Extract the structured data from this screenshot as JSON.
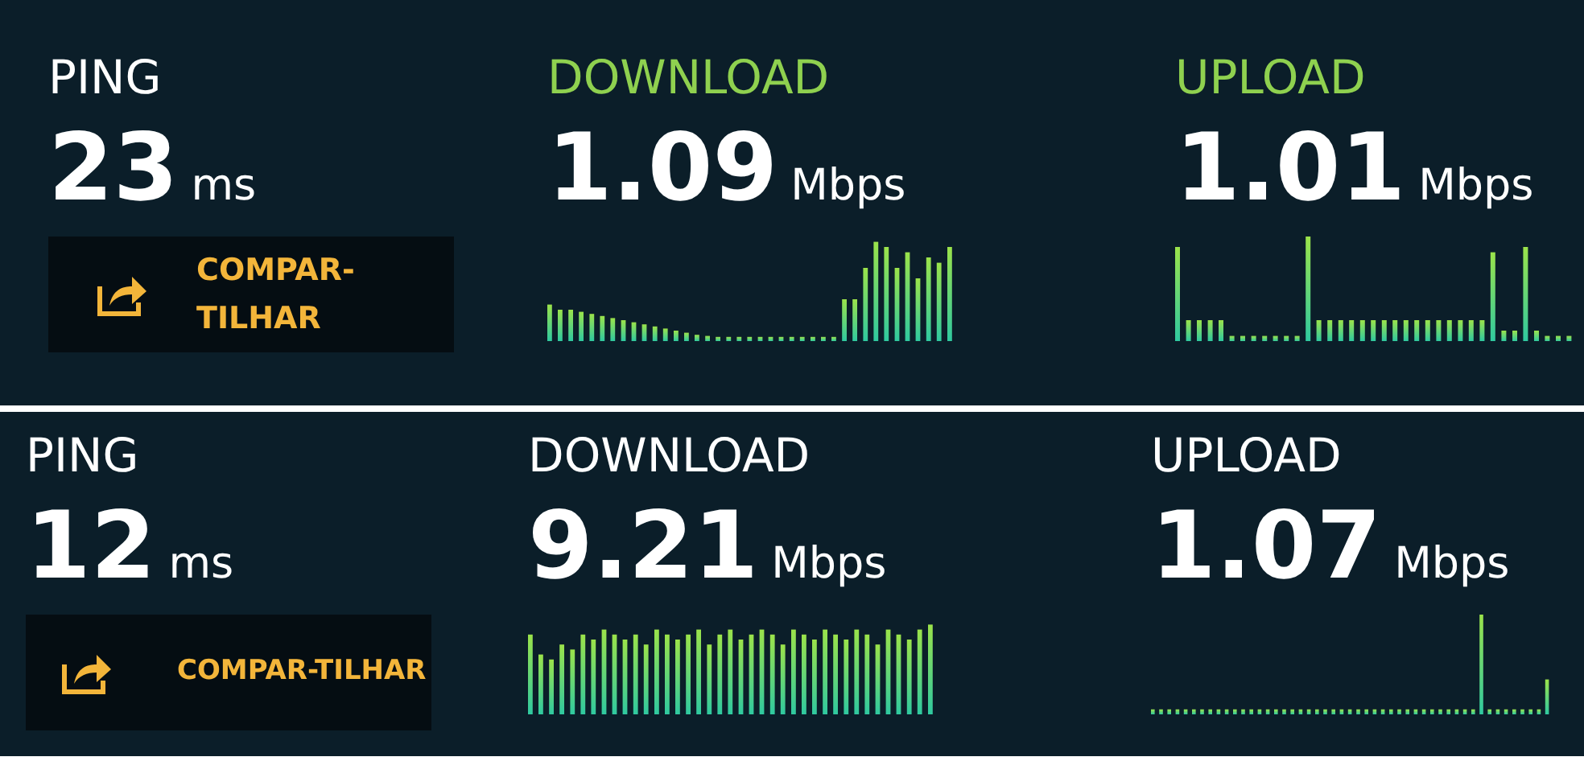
{
  "panels": [
    {
      "metrics": [
        {
          "label": "PING",
          "value": "23",
          "unit": "ms",
          "color": "#ffffff"
        },
        {
          "label": "DOWNLOAD",
          "value": "1.09",
          "unit": "Mbps",
          "color": "#8fd14f"
        },
        {
          "label": "UPLOAD",
          "value": "1.01",
          "unit": "Mbps",
          "color": "#8fd14f"
        }
      ],
      "share_button": "COMPAR-TILHAR"
    },
    {
      "metrics": [
        {
          "label": "PING",
          "value": "12",
          "unit": "ms",
          "color": "#ffffff"
        },
        {
          "label": "DOWNLOAD",
          "value": "9.21",
          "unit": "Mbps",
          "color": "#ffffff"
        },
        {
          "label": "UPLOAD",
          "value": "1.07",
          "unit": "Mbps",
          "color": "#ffffff"
        }
      ],
      "share_button": "COMPAR-TILHAR"
    }
  ]
}
